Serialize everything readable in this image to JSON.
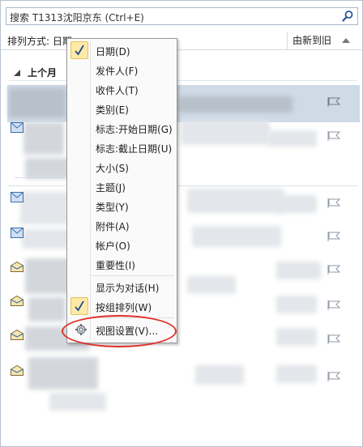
{
  "search": {
    "text": "搜索 T1313沈阳京东 (Ctrl+E)"
  },
  "sortbar": {
    "label": "排列方式: 日期",
    "order": "由新到旧"
  },
  "group": {
    "label": "上个月"
  },
  "menu": {
    "items": [
      {
        "label": "日期(D)",
        "checked": true
      },
      {
        "label": "发件人(F)",
        "checked": false
      },
      {
        "label": "收件人(T)",
        "checked": false
      },
      {
        "label": "类别(E)",
        "checked": false
      },
      {
        "label": "标志:开始日期(G)",
        "checked": false
      },
      {
        "label": "标志:截止日期(U)",
        "checked": false
      },
      {
        "label": "大小(S)",
        "checked": false
      },
      {
        "label": "主题(J)",
        "checked": false
      },
      {
        "label": "类型(Y)",
        "checked": false
      },
      {
        "label": "附件(A)",
        "checked": false
      },
      {
        "label": "帐户(O)",
        "checked": false
      },
      {
        "label": "重要性(I)",
        "checked": false
      }
    ],
    "conversation": {
      "label": "显示为对话(H)",
      "checked": false
    },
    "show_in_groups": {
      "label": "按组排列(W)",
      "checked": true
    },
    "view_settings": {
      "label": "视图设置(V)..."
    }
  },
  "icons": {
    "search": "search-icon",
    "check": "check-icon",
    "gear": "gear-icon",
    "flag": "flag-icon",
    "mail": "envelope-icon"
  },
  "colors": {
    "accent_check": "#fde9a8",
    "selected_row": "#cfdae7",
    "highlight_ellipse": "#e0302a"
  }
}
